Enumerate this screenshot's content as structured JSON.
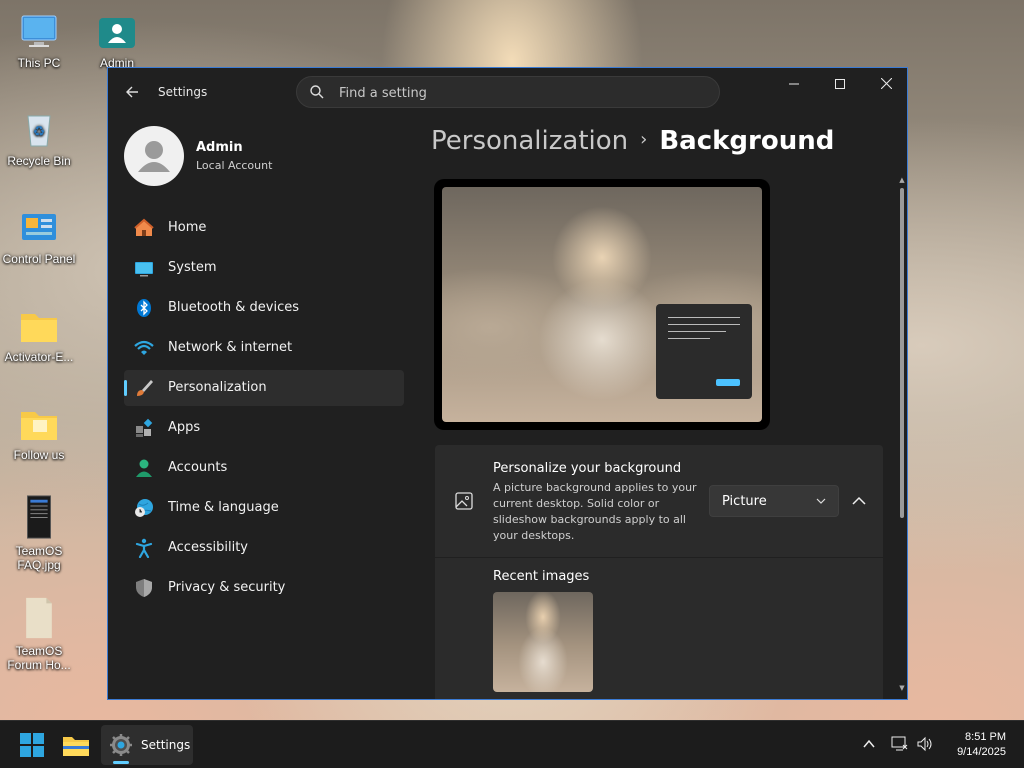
{
  "desktop": {
    "icons": [
      {
        "label": "This PC"
      },
      {
        "label": "Admin"
      },
      {
        "label": "Recycle Bin"
      },
      {
        "label": "Control Panel"
      },
      {
        "label": "Activator-E..."
      },
      {
        "label": "Follow us"
      },
      {
        "label": "TeamOS FAQ.jpg"
      },
      {
        "label": "TeamOS Forum Ho..."
      }
    ]
  },
  "window": {
    "app_title": "Settings",
    "search": {
      "placeholder": "Find a setting"
    },
    "controls": {
      "minimize": "—",
      "maximize": "☐",
      "close": "✕"
    },
    "profile": {
      "name": "Admin",
      "type": "Local Account"
    },
    "nav": [
      {
        "label": "Home",
        "icon": "home-icon"
      },
      {
        "label": "System",
        "icon": "system-icon"
      },
      {
        "label": "Bluetooth & devices",
        "icon": "bluetooth-icon"
      },
      {
        "label": "Network & internet",
        "icon": "wifi-icon"
      },
      {
        "label": "Personalization",
        "icon": "brush-icon",
        "active": true
      },
      {
        "label": "Apps",
        "icon": "apps-icon"
      },
      {
        "label": "Accounts",
        "icon": "accounts-icon"
      },
      {
        "label": "Time & language",
        "icon": "globe-clock-icon"
      },
      {
        "label": "Accessibility",
        "icon": "accessibility-icon"
      },
      {
        "label": "Privacy & security",
        "icon": "shield-icon"
      }
    ],
    "breadcrumb": {
      "parent": "Personalization",
      "separator": "›",
      "current": "Background"
    },
    "background_card": {
      "title": "Personalize your background",
      "description": "A picture background applies to your current desktop. Solid color or slideshow backgrounds apply to all your desktops.",
      "dropdown_value": "Picture"
    },
    "recent": {
      "title": "Recent images"
    }
  },
  "taskbar": {
    "settings_label": "Settings",
    "clock": {
      "time": "8:51 PM",
      "date": "9/14/2025"
    }
  },
  "colors": {
    "accent": "#60cdff",
    "window_bg": "#202020",
    "card_bg": "#2b2b2b"
  }
}
